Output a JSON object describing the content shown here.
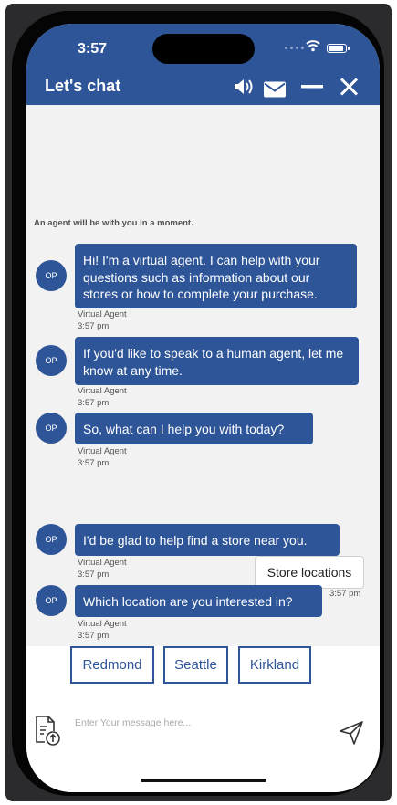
{
  "status_bar": {
    "time": "3:57"
  },
  "header": {
    "title": "Let's chat",
    "icons": [
      "speaker-icon",
      "mail-icon",
      "minimize-icon",
      "close-icon"
    ]
  },
  "chat": {
    "notice": "An agent will be with you in a moment.",
    "avatar_initials": "OP",
    "messages": [
      {
        "text": "Hi! I'm a virtual agent. I can help with your questions such as information about our stores or how to complete your purchase.",
        "sender": "Virtual Agent",
        "time": "3:57 pm"
      },
      {
        "text": "If you'd like to speak to a human agent, let me know at any time.",
        "sender": "Virtual Agent",
        "time": "3:57 pm"
      },
      {
        "text": "So, what can I help you with today?",
        "sender": "Virtual Agent",
        "time": "3:57 pm"
      },
      {
        "text": "I'd be glad to help find a store near you.",
        "sender": "Virtual Agent",
        "time": "3:57 pm"
      },
      {
        "text": "Which location are you interested in?",
        "sender": "Virtual Agent",
        "time": "3:57 pm"
      }
    ],
    "user_message": {
      "text": "Store locations",
      "time": "3:57 pm"
    }
  },
  "quick_replies": [
    "Redmond",
    "Seattle",
    "Kirkland"
  ],
  "composer": {
    "placeholder": "Enter Your message here..."
  },
  "colors": {
    "brand": "#2e5597",
    "background": "#f2f2f2"
  }
}
